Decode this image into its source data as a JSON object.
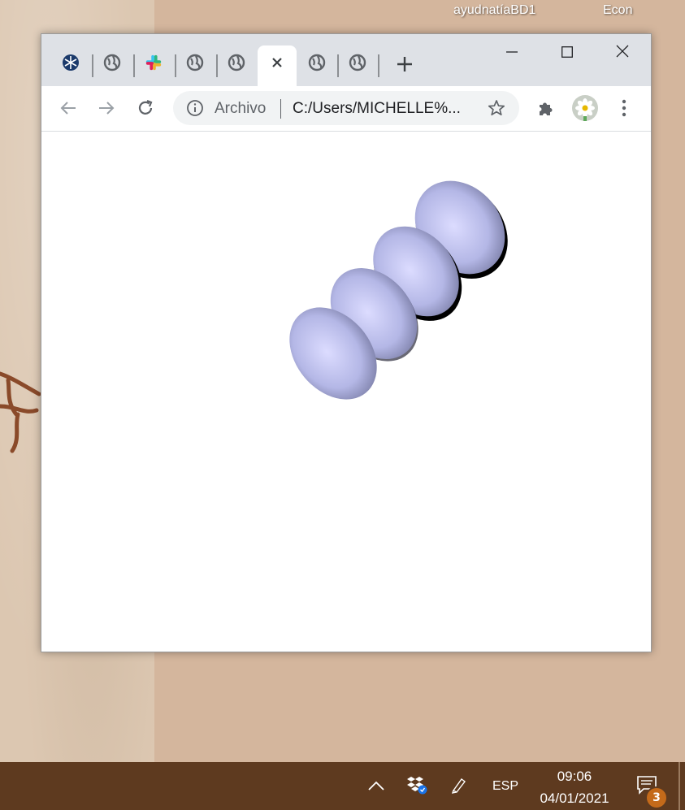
{
  "desktop": {
    "labels": [
      "ayudnatíaBD1",
      "Econ"
    ]
  },
  "browser": {
    "tabs": [
      {
        "icon": "snowflake-icon"
      },
      {
        "icon": "globe-icon"
      },
      {
        "icon": "slack-icon"
      },
      {
        "icon": "globe-icon"
      },
      {
        "icon": "globe-icon"
      },
      {
        "icon": "close-icon",
        "active": true
      },
      {
        "icon": "globe-icon"
      },
      {
        "icon": "globe-icon"
      }
    ],
    "window_controls": [
      "minimize-icon",
      "maximize-icon",
      "close-icon"
    ],
    "omnibox": {
      "security_label": "Archivo",
      "url": "C:/Users/MICHELLE%..."
    },
    "content": {
      "ellipsoid_count": 4,
      "ellipsoid_color": "#c8caf8"
    }
  },
  "taskbar": {
    "language": "ESP",
    "time": "09:06",
    "date": "04/01/2021",
    "notification_count": "3",
    "color": "#5e3a1f"
  }
}
